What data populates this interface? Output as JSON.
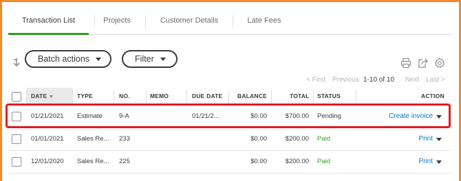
{
  "tabs": [
    {
      "label": "Transaction List",
      "active": true
    },
    {
      "label": "Projects",
      "active": false
    },
    {
      "label": "Customer Details",
      "active": false
    },
    {
      "label": "Late Fees",
      "active": false
    }
  ],
  "toolbar": {
    "batch_label": "Batch actions",
    "filter_label": "Filter"
  },
  "pager": {
    "first": "< First",
    "previous": "Previous",
    "range": "1-10 of 10",
    "next": "Next",
    "last": "Last >"
  },
  "table": {
    "columns": [
      "DATE",
      "TYPE",
      "NO.",
      "MEMO",
      "DUE DATE",
      "BALANCE",
      "TOTAL",
      "STATUS",
      "ACTION"
    ],
    "sort_indicator": "▼",
    "rows": [
      {
        "date": "01/21/2021",
        "type": "Estimate",
        "no": "9-A",
        "memo": "",
        "due": "01/21/2...",
        "balance": "$0.00",
        "total": "$700.00",
        "status": "Pending",
        "action": "Create invoice",
        "highlighted": true
      },
      {
        "date": "01/01/2021",
        "type": "Sales Re...",
        "no": "233",
        "memo": "",
        "due": "",
        "balance": "$0.00",
        "total": "$200.00",
        "status": "Paid",
        "action": "Print",
        "highlighted": false
      },
      {
        "date": "12/01/2020",
        "type": "Sales Re...",
        "no": "225",
        "memo": "",
        "due": "",
        "balance": "$0.00",
        "total": "$200.00",
        "status": "Paid",
        "action": "Print",
        "highlighted": false
      }
    ]
  },
  "colors": {
    "accent_green": "#2ca01c",
    "link_blue": "#0077c5",
    "highlight_red": "#e01b24",
    "frame_orange": "#f08a2a"
  },
  "icons": [
    "sort-arrow-icon",
    "print-icon",
    "export-icon",
    "settings-gear-icon",
    "caret-down-icon"
  ]
}
